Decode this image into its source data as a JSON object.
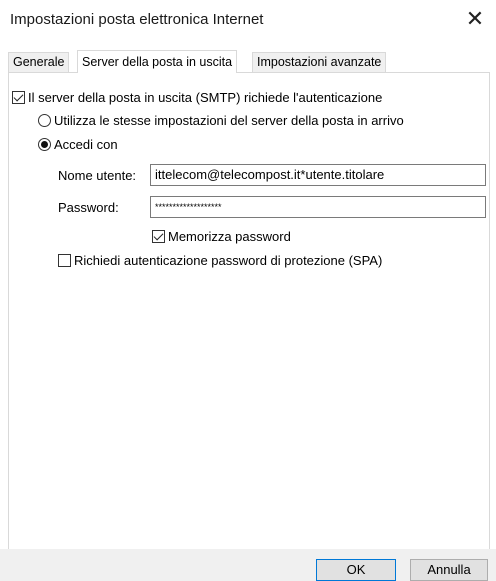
{
  "window": {
    "title": "Impostazioni posta elettronica Internet",
    "close_glyph": "✕"
  },
  "tabs": [
    {
      "label": "Generale",
      "active": false
    },
    {
      "label": "Server della posta in uscita",
      "active": true
    },
    {
      "label": "Impostazioni avanzate",
      "active": false
    }
  ],
  "smtp_auth": {
    "label": "Il server della posta in uscita (SMTP) richiede l'autenticazione",
    "checked": true
  },
  "options": {
    "same_settings_label": "Utilizza le stesse impostazioni del server della posta in arrivo",
    "same_settings_selected": false,
    "login_label": "Accedi con",
    "login_selected": true
  },
  "credentials": {
    "username_label": "Nome utente:",
    "username_value": "ittelecom@telecompost.it*utente.titolare",
    "password_label": "Password:",
    "password_value": "*******************"
  },
  "remember_password": {
    "label": "Memorizza password",
    "checked": true
  },
  "spa": {
    "label": "Richiedi autenticazione password di protezione (SPA)",
    "checked": false
  },
  "buttons": {
    "ok": "OK",
    "cancel": "Annulla"
  }
}
